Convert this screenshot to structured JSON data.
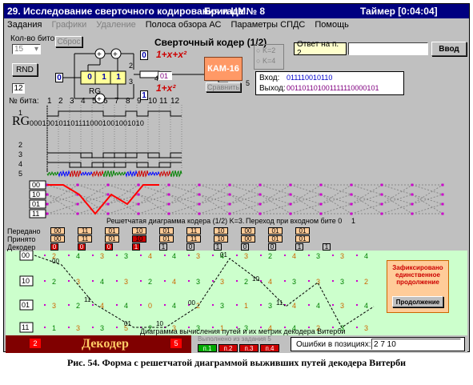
{
  "window": {
    "title": "29. Исследование сверточного кодирования и ЦМ.",
    "brigade": "Бригада № 8",
    "timer": "Таймер [0:04:04]"
  },
  "menu": [
    {
      "label": "Задания",
      "enabled": true
    },
    {
      "label": "Графики",
      "enabled": false
    },
    {
      "label": "Удаление",
      "enabled": false
    },
    {
      "label": "Полоса обзора АС",
      "enabled": true
    },
    {
      "label": "Параметры СПДС",
      "enabled": true
    },
    {
      "label": "Помощь",
      "enabled": true
    }
  ],
  "encoder": {
    "bits_label": "Кол-во битов",
    "bits_value": "15",
    "reset_button": "Сброс",
    "rnd_button": "RND",
    "title": "Сверточный кодер (1/2)",
    "poly_top": "1+x+x²",
    "poly_bottom": "1+x²",
    "register_bits": [
      "0",
      "1",
      "1"
    ],
    "register_label": "RG",
    "input_bit": "0",
    "out_top": "0",
    "out_bottom": "1",
    "mod_label": "КАМ-16",
    "mod_button": "Сравнить",
    "count": "12",
    "k_options": [
      "K=2",
      "K=4"
    ],
    "mux_pos": [
      "1",
      "2",
      "3",
      "4",
      "5"
    ],
    "mux_value": "01"
  },
  "answer": {
    "label": "Ответ на п. 2.",
    "value": "",
    "enter_button": "Ввод"
  },
  "io": {
    "in_label": "Вход:",
    "in_value": "011110010110",
    "out_label": "Выход:",
    "out_value": "001101101001111110000101"
  },
  "timing": {
    "bit_label": "№ бита:",
    "bit_numbers": [
      "1",
      "2",
      "3",
      "4",
      "5",
      "6",
      "7",
      "8",
      "9",
      "10",
      "11",
      "12"
    ],
    "rg_label": "RG",
    "rg_bits": "0001001011011110001001001010",
    "rows": [
      "1",
      "2",
      "3",
      "4",
      "5"
    ]
  },
  "trellis": {
    "states": [
      "00",
      "10",
      "01",
      "11"
    ],
    "caption": "Решетчатая диаграмма кодера (1/2) K=3.",
    "legend0": "Переход при входном бите 0",
    "legend1": "1"
  },
  "sequences": {
    "sent_label": "Передано",
    "recv_label": "Принято",
    "dec_label": "Декодер",
    "sent": [
      "00",
      "11",
      "01",
      "10",
      "01",
      "11",
      "10",
      "00",
      "01",
      "01"
    ],
    "recv": [
      "00",
      "11",
      "01",
      "10",
      "01",
      "11",
      "10",
      "00",
      "01",
      "01"
    ],
    "recv_err": [
      false,
      false,
      false,
      true,
      false,
      false,
      false,
      false,
      false,
      false
    ],
    "dec": [
      "0",
      "0",
      "0",
      "1",
      "1",
      "0",
      "1",
      "0",
      "0",
      "1",
      "1"
    ]
  },
  "decoder": {
    "states": [
      "00",
      "10",
      "01",
      "11"
    ],
    "caption": "Диаграмма вычисления путей и их метрик декодера Витерби",
    "notice": "Зафиксировано единственное продолжение",
    "continue_button": "Продолжение",
    "metric_rows": [
      [
        "2",
        "4",
        "3",
        "3",
        "4",
        "4",
        "3",
        "4",
        "3",
        "2",
        "4",
        "3",
        "3",
        "4"
      ],
      [
        "2",
        "3",
        "4",
        "3",
        "2",
        "4",
        "3",
        "3",
        "2",
        "4",
        "3",
        "3",
        "3",
        "2"
      ],
      [
        "3",
        "2",
        "4",
        "4",
        "0",
        "4",
        "2",
        "3",
        "1",
        "3",
        "4",
        "4",
        "3",
        "4"
      ],
      [
        "1",
        "3",
        "3",
        "5",
        "2",
        "3",
        "3",
        "1",
        "3",
        "4",
        "4",
        "2",
        "3",
        "3"
      ]
    ],
    "branch_labels": [
      "00",
      "11",
      "01",
      "10",
      "00",
      "01",
      "10",
      "11"
    ]
  },
  "status": {
    "left_count": "2",
    "title": "Декодер",
    "right_count": "5",
    "done_label": "Выполнено из задания 5",
    "progress_items": [
      "п.1",
      "п.2",
      "п.3",
      "п.4"
    ],
    "errors_label": "Ошибки в позициях:",
    "errors_value": "2 7 10"
  },
  "caption": "Рис. 54. Форма с решетчатой диаграммой выживших путей декодера Витерби",
  "colors": {
    "title_bg": "#000080",
    "trellis_red": "#ff0000",
    "decoder_bg": "#ccffcc",
    "status_dark": "#800000",
    "mod_orange": "#ff9966",
    "dot_magenta": "#cc00cc"
  }
}
